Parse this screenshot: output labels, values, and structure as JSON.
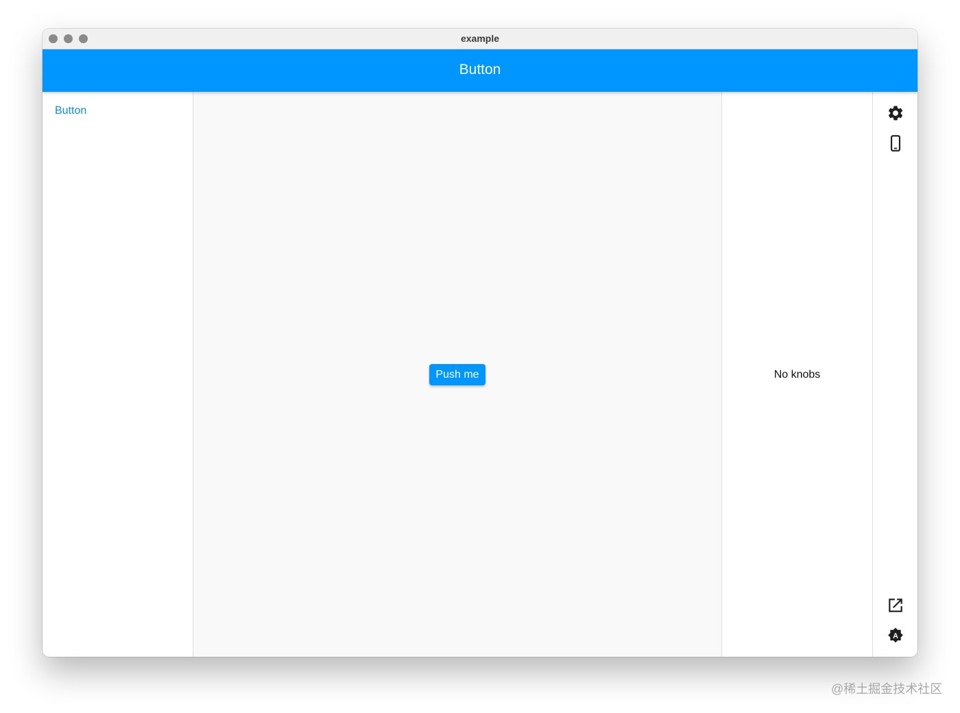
{
  "window": {
    "title": "example"
  },
  "appbar": {
    "title": "Button",
    "color": "#0096ff"
  },
  "sidebar": {
    "items": [
      {
        "label": "Button",
        "selected": true
      }
    ]
  },
  "canvas": {
    "button_label": "Push me"
  },
  "knobs": {
    "empty_text": "No knobs"
  },
  "rail": {
    "top_icons": [
      "settings-icon",
      "phone-device-icon"
    ],
    "bottom_icons": [
      "open-in-new-icon",
      "auto-theme-icon"
    ]
  },
  "watermark": {
    "text": "@稀土掘金技术社区"
  }
}
